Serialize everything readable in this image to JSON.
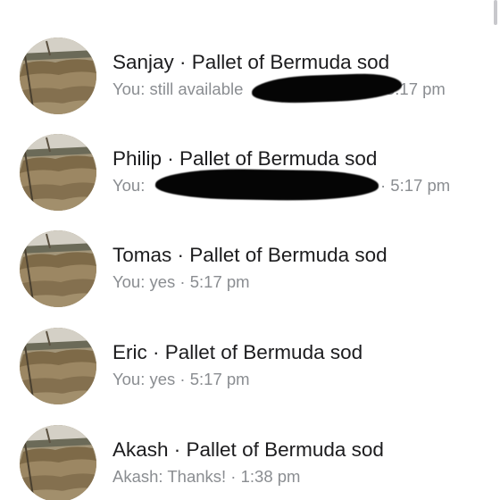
{
  "conversations": [
    {
      "title": "Sanjay · Pallet of Bermuda sod",
      "preview": "You: still available",
      "time": "5:17 pm"
    },
    {
      "title": "Philip · Pallet of Bermuda sod",
      "preview": "You:",
      "time": "· 5:17 pm"
    },
    {
      "title": "Tomas · Pallet of Bermuda sod",
      "preview": "You: yes · 5:17 pm"
    },
    {
      "title": "Eric · Pallet of Bermuda sod",
      "preview": "You: yes · 5:17 pm"
    },
    {
      "title": "Akash · Pallet of Bermuda sod",
      "preview": "Akash: Thanks! · 1:38 pm"
    }
  ],
  "colors": {
    "title": "#1c1c1e",
    "subtitle": "#8a8d91",
    "redaction": "#050505"
  },
  "icons": {
    "avatar": "sod-pallet-photo"
  }
}
